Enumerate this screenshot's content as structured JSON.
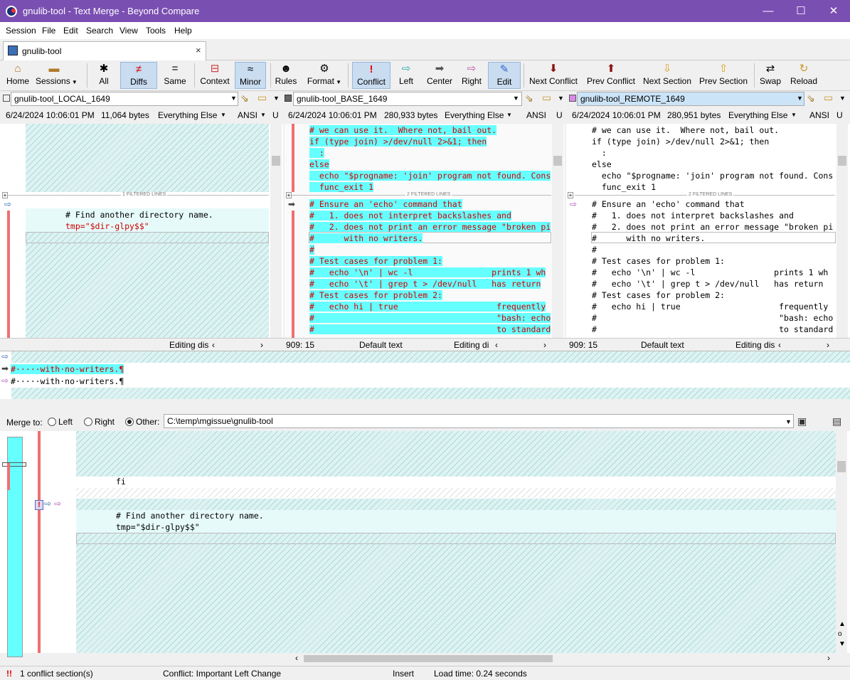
{
  "window": {
    "title": "gnulib-tool - Text Merge - Beyond Compare",
    "minimize": "—",
    "maximize": "☐",
    "close": "✕"
  },
  "menu": [
    "Session",
    "File",
    "Edit",
    "Search",
    "View",
    "Tools",
    "Help"
  ],
  "tab": {
    "label": "gnulib-tool",
    "close": "×"
  },
  "toolbar": {
    "home": "Home",
    "sessions": "Sessions",
    "all": "All",
    "diffs": "Diffs",
    "same": "Same",
    "context": "Context",
    "minor": "Minor",
    "rules": "Rules",
    "format": "Format",
    "conflict": "Conflict",
    "left": "Left",
    "center": "Center",
    "right": "Right",
    "edit": "Edit",
    "next_conflict": "Next Conflict",
    "prev_conflict": "Prev Conflict",
    "next_section": "Next Section",
    "prev_section": "Prev Section",
    "swap": "Swap",
    "reload": "Reload"
  },
  "panes": [
    {
      "path": "gnulib-tool_LOCAL_1649",
      "date": "6/24/2024 10:06:01 PM",
      "size": "11,064 bytes",
      "format": "Everything Else",
      "enc": "ANSI",
      "enc2": "U",
      "color": "#6fd8e8",
      "filtered": "1 FILTERED LINES",
      "status_text": "Editing dis",
      "pos": "",
      "default_text": ""
    },
    {
      "path": "gnulib-tool_BASE_1649",
      "date": "6/24/2024 10:06:01 PM",
      "size": "280,933 bytes",
      "format": "Everything Else",
      "enc": "ANSI",
      "enc2": "U",
      "color": "#666666",
      "filtered": "2 FILTERED LINES",
      "status_text": "Editing di",
      "pos": "909: 15",
      "default_text": "Default text"
    },
    {
      "path": "gnulib-tool_REMOTE_1649",
      "date": "6/24/2024 10:06:01 PM",
      "size": "280,951 bytes",
      "format": "Everything Else",
      "enc": "ANSI",
      "enc2": "U",
      "color": "#d98ae6",
      "filtered": "2 FILTERED LINES",
      "status_text": "Editing dis",
      "pos": "909: 15",
      "default_text": "Default text"
    }
  ],
  "left_code": {
    "l1": "# Find another directory name.",
    "l2": "tmp=\"$dir-glpy$$\""
  },
  "base_top": [
    "# we can use it.  Where not, bail out.",
    "if (type join) >/dev/null 2>&1; then",
    "  :",
    "else",
    "  echo \"$progname: 'join' program not found. Cons",
    "  func_exit 1"
  ],
  "base_bottom": [
    "# Ensure an 'echo' command that",
    "#   1. does not interpret backslashes and",
    "#   2. does not print an error message \"broken pi",
    "#      with no writers.",
    "#",
    "# Test cases for problem 1:",
    "#   echo '\\n' | wc -l                prints 1 wh",
    "#   echo '\\t' | grep t > /dev/null   has return",
    "# Test cases for problem 2:",
    "#   echo hi | true                    frequently",
    "#                                     \"bash: echo",
    "#                                     to standard"
  ],
  "merge_lines": {
    "line1": "#·····with·no·writers.¶",
    "line2": "#·····with·no·writers.¶"
  },
  "merge_to": {
    "label": "Merge to:",
    "left": "Left",
    "right": "Right",
    "other": "Other:",
    "path": "C:\\temp\\mgissue\\gnulib-tool"
  },
  "output": {
    "fi": "fi",
    "l1": "# Find another directory name.",
    "l2": "tmp=\"$dir-glpy$$\""
  },
  "status": {
    "conflicts": "1 conflict section(s)",
    "conflict_type": "Conflict: Important Left Change",
    "mode": "Insert",
    "load": "Load time: 0.24 seconds"
  }
}
